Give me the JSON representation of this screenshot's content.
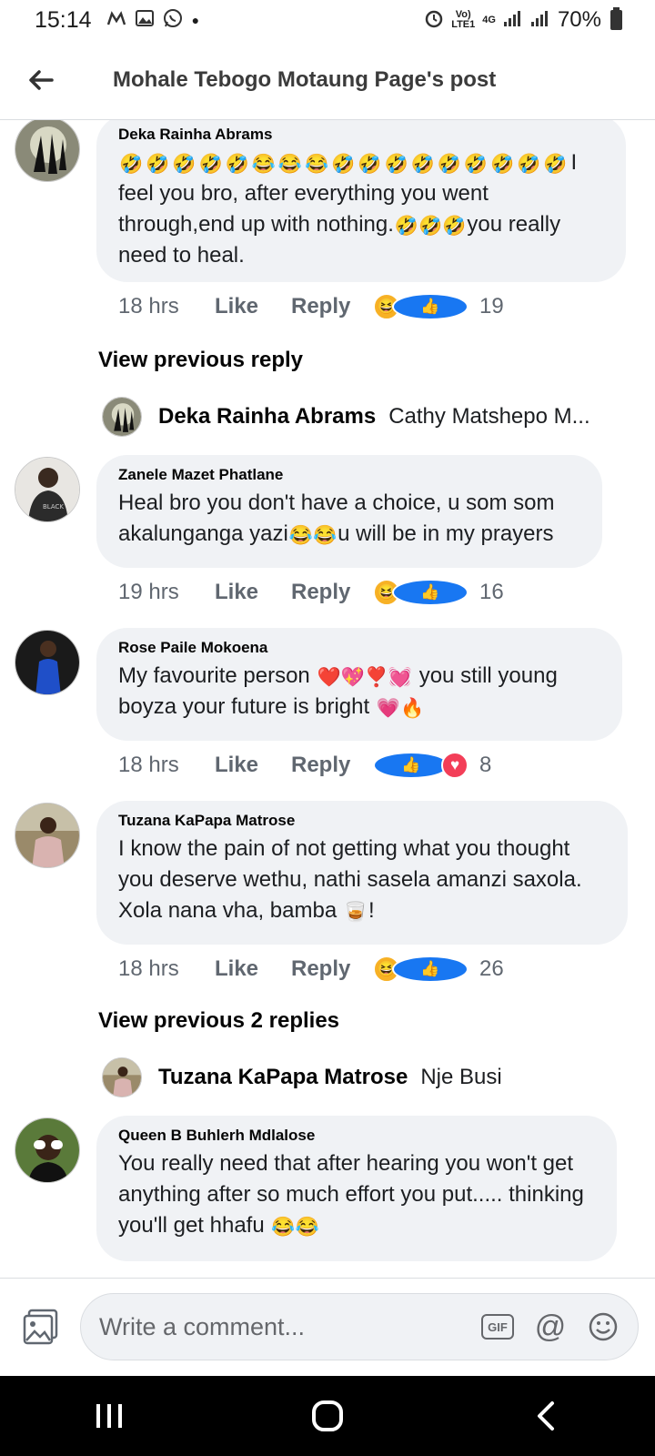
{
  "status_bar": {
    "time": "15:14",
    "battery": "70%",
    "network_label": "4G"
  },
  "header": {
    "title": "Mohale Tebogo Motaung Page's post"
  },
  "comments": [
    {
      "name": "Deka Rainha Abrams",
      "lead_emojis": "🤣🤣🤣🤣🤣😂😂😂🤣🤣🤣🤣🤣🤣🤣🤣🤣",
      "text1": "I feel you bro, after everything you went through,end up with nothing.",
      "mid_emojis": "🤣🤣🤣",
      "text2": "you really need to heal.",
      "time": "18 hrs",
      "like": "Like",
      "reply": "Reply",
      "reaction_count": "19"
    },
    {
      "name": "Zanele Mazet Phatlane",
      "text1": "Heal bro you don't have a choice, u som som akalunganga yazi",
      "mid_emojis": "😂😂",
      "text2": "u will be in my prayers",
      "time": "19 hrs",
      "like": "Like",
      "reply": "Reply",
      "reaction_count": "16"
    },
    {
      "name": "Rose Paile Mokoena",
      "text1": "My favourite person",
      "mid_emojis": "❤️💖❣️💓",
      "text2": "you still young boyza your future is bright",
      "end_emojis": "💗🔥",
      "time": "18 hrs",
      "like": "Like",
      "reply": "Reply",
      "reaction_count": "8"
    },
    {
      "name": "Tuzana KaPapa Matrose",
      "text1": "I know the pain of not getting what you thought you deserve wethu, nathi sasela amanzi saxola. Xola nana vha, bamba",
      "mid_emojis": "🥃",
      "text2": "!",
      "time": "18 hrs",
      "like": "Like",
      "reply": "Reply",
      "reaction_count": "26"
    },
    {
      "name": "Queen B Buhlerh Mdlalose",
      "text1": "You really need that after hearing you won't get anything after so much effort you put..... thinking you'll get hhafu",
      "mid_emojis": "😂😂"
    }
  ],
  "view_previous": [
    {
      "label": "View previous reply"
    },
    {
      "label": "View previous 2 replies"
    }
  ],
  "replies": [
    {
      "name": "Deka Rainha Abrams",
      "text": "Cathy Matshepo  M..."
    },
    {
      "name": "Tuzana KaPapa Matrose",
      "text": "Nje Busi"
    }
  ],
  "composer": {
    "placeholder": "Write a comment...",
    "gif_label": "GIF"
  },
  "colors": {
    "bubble": "#f0f2f5",
    "meta_text": "#606770",
    "like_blue": "#1877f2",
    "haha_yellow": "#f7b125",
    "love_red": "#f33e58"
  }
}
